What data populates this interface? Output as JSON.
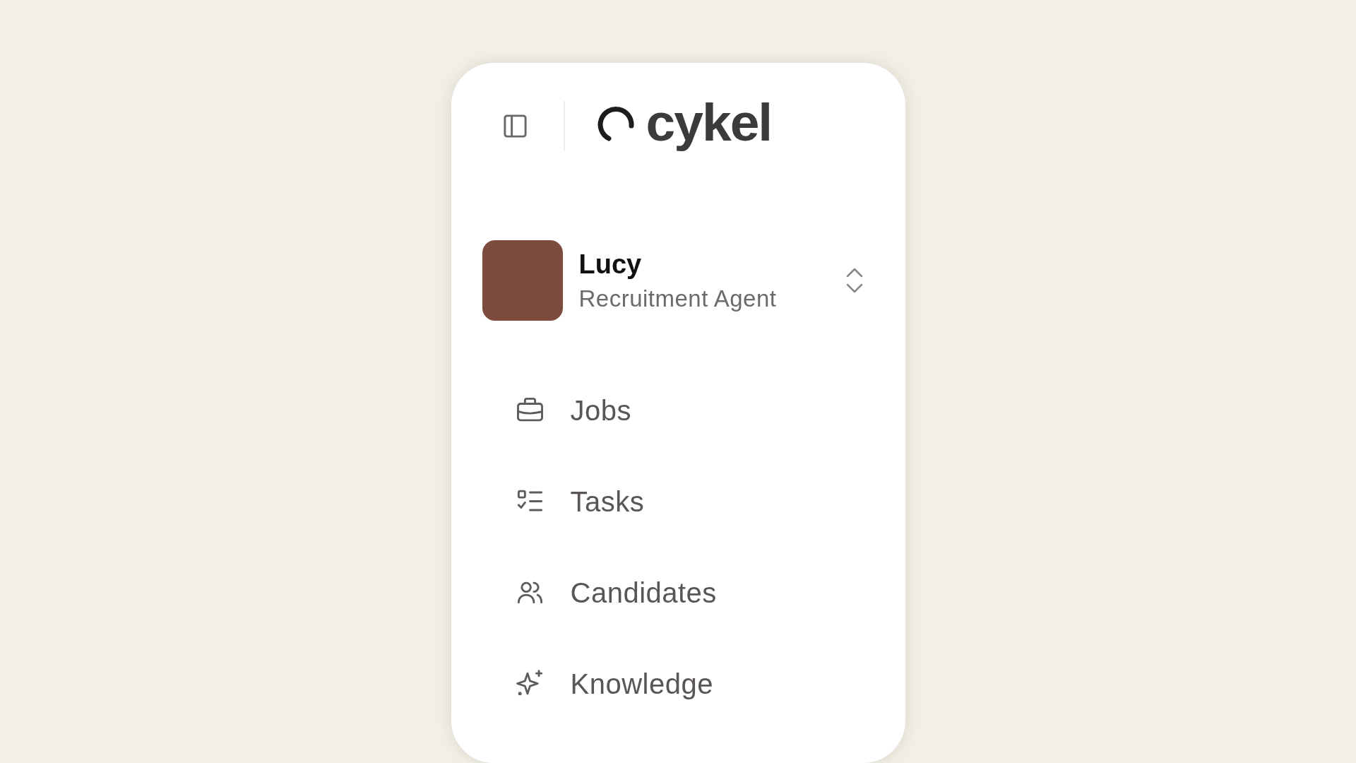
{
  "header": {
    "logo_text": "cykel"
  },
  "profile": {
    "name": "Lucy",
    "role": "Recruitment Agent"
  },
  "nav": [
    {
      "label": "Jobs",
      "selected": false
    },
    {
      "label": "Tasks",
      "selected": false
    },
    {
      "label": "Candidates",
      "selected": false
    },
    {
      "label": "Knowledge",
      "selected": false
    }
  ]
}
